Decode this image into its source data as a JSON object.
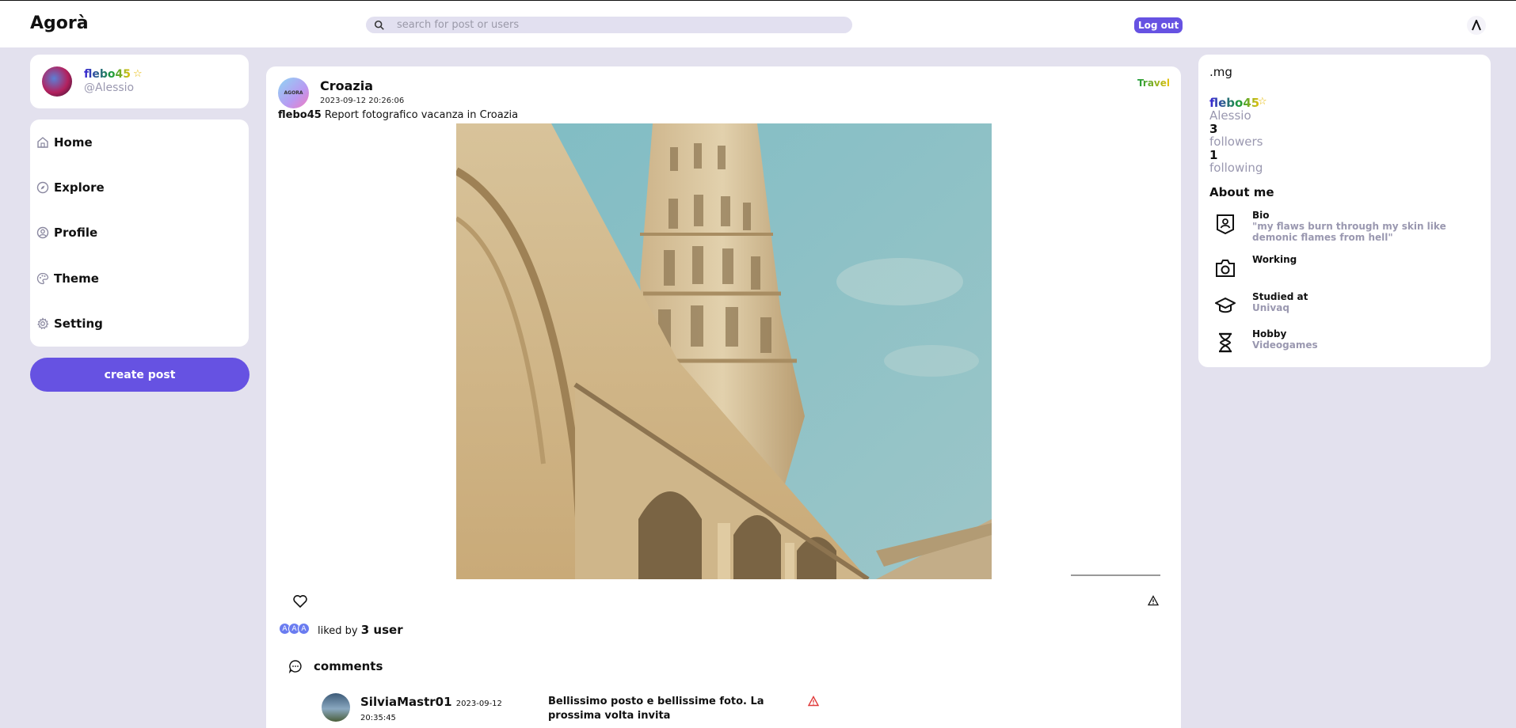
{
  "app": {
    "name": "Agorà"
  },
  "search": {
    "placeholder": "search for post or users"
  },
  "header": {
    "logout_label": "Log out"
  },
  "user_card": {
    "username": "flebo45",
    "handle": "@Alessio"
  },
  "nav": {
    "items": [
      {
        "label": "Home",
        "icon": "home-icon"
      },
      {
        "label": "Explore",
        "icon": "compass-icon"
      },
      {
        "label": "Profile",
        "icon": "user-icon"
      },
      {
        "label": "Theme",
        "icon": "palette-icon"
      },
      {
        "label": "Setting",
        "icon": "gear-icon"
      }
    ],
    "create_label": "create post"
  },
  "post": {
    "avatar_text": "AGORA",
    "title": "Croazia",
    "date": "2023-09-12 20:26:06",
    "category": "Travel",
    "author": "flebo45",
    "caption": "Report fotografico vacanza in Croazia",
    "liked_by_prefix": "liked by",
    "liked_by_count": "3 user",
    "likers": [
      "A",
      "A",
      "A"
    ],
    "comments_label": "comments"
  },
  "comment": {
    "user": "SilviaMastr01",
    "date": "2023-09-12",
    "time": "20:35:45",
    "text": "Bellissimo posto e bellissime foto. La prossima volta invita"
  },
  "profile": {
    "header": ".mg",
    "username": "flebo45",
    "name": "Alessio",
    "followers_count": "3",
    "followers_label": "followers",
    "following_count": "1",
    "following_label": "following",
    "about_title": "About me",
    "info": [
      {
        "label": "Bio",
        "value": "\"my flaws burn through my skin like demonic flames from hell\"",
        "icon": "id-badge-icon"
      },
      {
        "label": "Working",
        "value": "",
        "icon": "camera-icon"
      },
      {
        "label": "Studied at",
        "value": "Univaq",
        "icon": "graduation-cap-icon"
      },
      {
        "label": "Hobby",
        "value": "Videogames",
        "icon": "hourglass-icon"
      }
    ]
  },
  "colors": {
    "accent": "#6652e2",
    "background": "#e3e1ee",
    "muted": "#9a98b0"
  }
}
